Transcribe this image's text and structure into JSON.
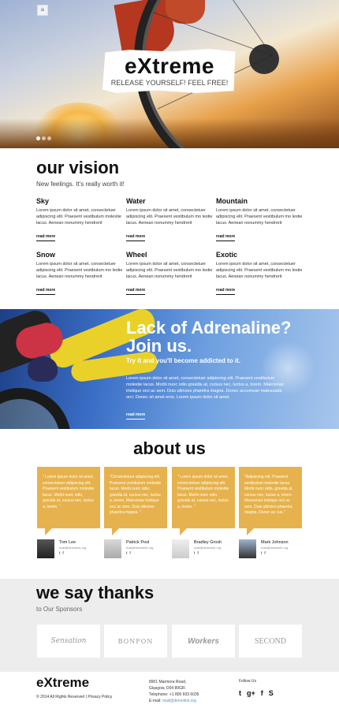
{
  "hero": {
    "menu_icon": "menu-icon",
    "title": "eXtreme",
    "tagline": "RELEASE YOURSELF! FEEL FREE!",
    "slides": 3,
    "active_slide": 1
  },
  "vision": {
    "title": "our vision",
    "subtitle": "New feelings. It's really worth it!",
    "items": [
      {
        "title": "Sky",
        "text": "Lorem ipsum dolor sit amet, consectetuer adipiscing elit. Praesent vestibulum molestie lacus. Aenean nonummy hendrerit",
        "more": "read more"
      },
      {
        "title": "Water",
        "text": "Lorem ipsum dolor sit amet, consectetuer adipiscing elit. Praesent vestibulum mo lestie lacus. Aenean nonummy hendrerit",
        "more": "read more"
      },
      {
        "title": "Mountain",
        "text": "Lorem ipsum dolor sit amet, consectetuer adipiscing elit. Praesent vestibulum mo lestie lacus. Aenean nonummy hendrerit",
        "more": "read more"
      },
      {
        "title": "Snow",
        "text": "Lorem ipsum dolor sit amet, consectetuer adipiscing elit. Praesent vestibulum mo lestie lacus. Aenean nonummy hendrerit",
        "more": "read more"
      },
      {
        "title": "Wheel",
        "text": "Lorem ipsum dolor sit amet, consectetuer adipiscing elit. Praesent vestibulum mo lestie lacus. Aenean nonummy hendrerit",
        "more": "read more"
      },
      {
        "title": "Exotic",
        "text": "Lorem ipsum dolor sit amet, consectetuer adipiscing elit. Praesent vestibulum mo lestie lacus. Aenean nonummy hendrerit",
        "more": "read more"
      }
    ]
  },
  "banner": {
    "title": "Lack of Adrenaline? Join us.",
    "subtitle": "Try it and you'll become addicted to it.",
    "text": "Lorem ipsum dolor sit amet, consectetuer adipiscing elit. Praesent vestibulum molestie lacus. Morbi nunc odio gravida at, cursus nec, luctus a, lorem. Maecenas tristique orci ac sem. Duis ultricies pharetra magna. Donec accumsan malesuada orci. Donec sit amet eros. Lorem ipsum dolor sit amet.",
    "more": "read more"
  },
  "about": {
    "title": "about us",
    "testimonials": [
      {
        "quote": "\" Lorem ipsum dolor sit amet, consectetuer adipiscing elit. Praesent vestibulum molestie lacus. Morbi nunc odio, gravida at, cursus nec, luctus a, lorem. \"",
        "name": "Tom Lee",
        "email": "mail@demolink.org"
      },
      {
        "quote": "\"Consectetuer adipiscing elit. Praesent vestibulum molestie lacus. Morbi nunc odio, gravida at, cursus nec, luctus a, lorem. Maecenas tristique orci ac sem. Duis ultricies pharetra magna. \"",
        "name": "Patrick Pool",
        "email": "mail@demolink.org"
      },
      {
        "quote": "\" Lorem ipsum dolor sit amet, consectetuer adipiscing elit. Praesent vestibulum molestie lacus. Morbi nunc odio, gravida at, cursus nec, luctus a, lorem. \"",
        "name": "Bradley Grosh",
        "email": "mail@demolink.org"
      },
      {
        "quote": "\"Adipiscing elit. Praesent vestibulum molestie lacus. Morbi nunc odio, gravida at, cursus nec, luctus a, lorem. Maecenas tristique orci ac sem. Duis ultricies pharetra magna. Donec ac cus.\"",
        "name": "Mark Johnson",
        "email": "mail@demolink.org"
      }
    ]
  },
  "thanks": {
    "title": "we say thanks",
    "subtitle": "to Our Sponsors",
    "sponsors": [
      "Sensation",
      "BONFON",
      "Workers",
      "SECOND"
    ]
  },
  "footer": {
    "logo": "eXtreme",
    "copyright": "© 2014 All Rights Reserved",
    "separator": "|",
    "privacy": "Privacy Policy",
    "address_line1": "8901 Marmora Road,",
    "address_line2": "Glasgow, D04 89GR.",
    "phone": "Telephone: +1 800 603 6035",
    "email_label": "E-mail:",
    "email": "mail@demolink.org",
    "follow_label": "Follow Us",
    "social": {
      "twitter": "t",
      "gplus": "g+",
      "facebook": "f",
      "skype": "S"
    }
  },
  "colors": {
    "accent": "#e6b24d",
    "banner": "#3a6ec6",
    "gray_band": "#ededed"
  }
}
